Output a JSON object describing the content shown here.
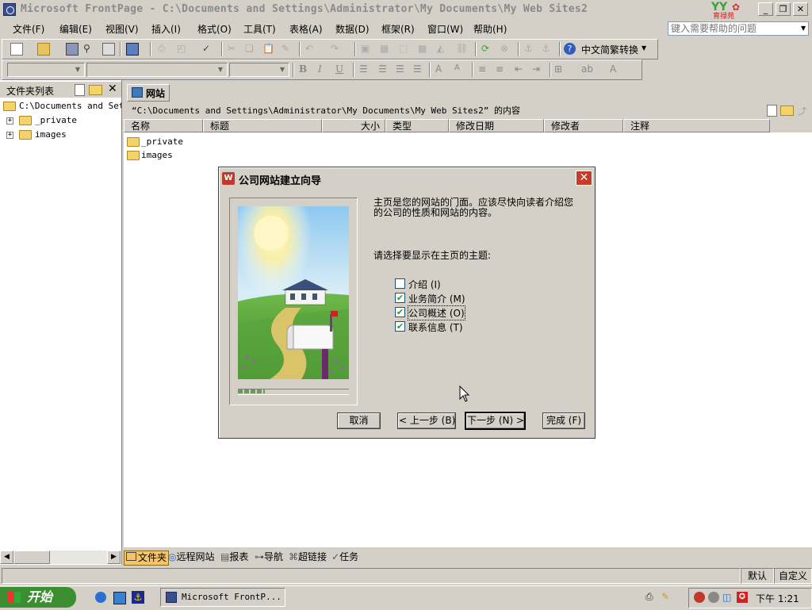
{
  "window": {
    "title": "Microsoft FrontPage - C:\\Documents and Settings\\Administrator\\My Documents\\My Web Sites2",
    "logo_text": "育禄苑",
    "controls": {
      "minimize": "_",
      "restore": "❐",
      "close": "✕"
    }
  },
  "menu": {
    "items": [
      "文件(F)",
      "编辑(E)",
      "视图(V)",
      "插入(I)",
      "格式(O)",
      "工具(T)",
      "表格(A)",
      "数据(D)",
      "框架(R)",
      "窗口(W)",
      "帮助(H)"
    ],
    "help_placeholder": "键入需要帮助的问题"
  },
  "toolbar": {
    "convert_label": "中文简繁转换",
    "format_bold": "B",
    "format_italic": "I",
    "format_underline": "U"
  },
  "left_panel": {
    "title": "文件夹列表",
    "root": "C:\\Documents and Sett",
    "items": [
      "_private",
      "images"
    ]
  },
  "main": {
    "tab_label": "网站",
    "path": "“C:\\Documents and Settings\\Administrator\\My Documents\\My Web Sites2” 的内容",
    "columns": [
      "名称",
      "标题",
      "大小",
      "类型",
      "修改日期",
      "修改者",
      "注释"
    ],
    "files": [
      "_private",
      "images"
    ]
  },
  "dialog": {
    "title": "公司网站建立向导",
    "intro": "主页是您的网站的门面。应该尽快向读者介绍您的公司的性质和网站的内容。",
    "prompt": "请选择要显示在主页的主题:",
    "options": [
      {
        "label": "介绍 (I)",
        "checked": false
      },
      {
        "label": "业务简介 (M)",
        "checked": true
      },
      {
        "label": "公司概述 (O)",
        "checked": true
      },
      {
        "label": "联系信息 (T)",
        "checked": true
      }
    ],
    "buttons": {
      "cancel": "取消",
      "back": "< 上一步 (B)",
      "next": "下一步 (N) >",
      "finish": "完成 (F)"
    }
  },
  "views": [
    "文件夹",
    "远程网站",
    "报表",
    "导航",
    "超链接",
    "任务"
  ],
  "status": {
    "default": "默认",
    "custom": "自定义"
  },
  "taskbar": {
    "start": "开始",
    "task": "Microsoft FrontP...",
    "clock": "下午 1:21"
  },
  "colors": {
    "title_blue": "#0a246a",
    "start_green": "#3c8f31",
    "close_red": "#c43c2a"
  }
}
